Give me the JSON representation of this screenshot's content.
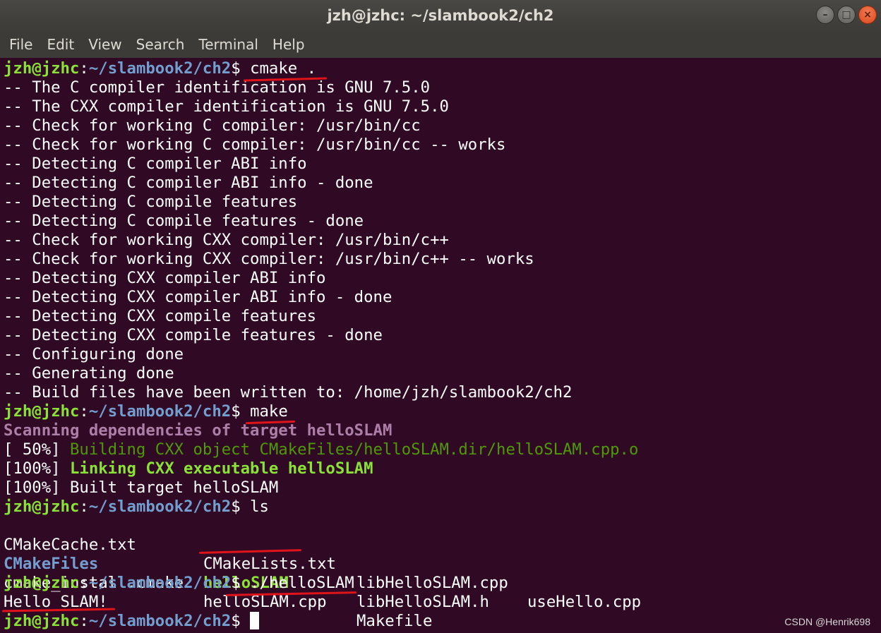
{
  "window": {
    "title": "jzh@jzhc: ~/slambook2/ch2",
    "buttons": {
      "minimize": "–",
      "maximize": "□",
      "close": "×"
    }
  },
  "menu": [
    "File",
    "Edit",
    "View",
    "Search",
    "Terminal",
    "Help"
  ],
  "prompt": {
    "user": "jzh@jzhc",
    "sep": ":",
    "path": "~/slambook2/ch2",
    "symbol": "$ "
  },
  "terminal": {
    "cmd1": "cmake .",
    "cmake_output": [
      "-- The C compiler identification is GNU 7.5.0",
      "-- The CXX compiler identification is GNU 7.5.0",
      "-- Check for working C compiler: /usr/bin/cc",
      "-- Check for working C compiler: /usr/bin/cc -- works",
      "-- Detecting C compiler ABI info",
      "-- Detecting C compiler ABI info - done",
      "-- Detecting C compile features",
      "-- Detecting C compile features - done",
      "-- Check for working CXX compiler: /usr/bin/c++",
      "-- Check for working CXX compiler: /usr/bin/c++ -- works",
      "-- Detecting CXX compiler ABI info",
      "-- Detecting CXX compiler ABI info - done",
      "-- Detecting CXX compile features",
      "-- Detecting CXX compile features - done",
      "-- Configuring done",
      "-- Generating done",
      "-- Build files have been written to: /home/jzh/slambook2/ch2"
    ],
    "cmd2": "make",
    "scan_line": "Scanning dependencies of target helloSLAM",
    "build_pct": "[ 50%] ",
    "build_msg": "Building CXX object CMakeFiles/helloSLAM.dir/helloSLAM.cpp.o",
    "link_pct": "[100%] ",
    "link_msg": "Linking CXX executable helloSLAM",
    "built_line": "[100%] Built target helloSLAM",
    "cmd3": "ls",
    "files": {
      "r1c1": "CMakeCache.txt",
      "r1c2": "CMakeLists.txt",
      "r1c3": "libHelloSLAM.cpp",
      "r1c4": "useHello.cpp",
      "r2c1": "CMakeFiles",
      "r2c2": "helloSLAM",
      "r2c3": "libHelloSLAM.h",
      "r3c1": "cmake_install.cmake",
      "r3c2": "helloSLAM.cpp",
      "r3c3": "Makefile"
    },
    "cmd4": "./helloSLAM",
    "program_output": "Hello SLAM!"
  },
  "watermark": "CSDN @Henrik698",
  "colors": {
    "background": "#300a24",
    "prompt_user": "#8ae234",
    "prompt_path": "#729fcf",
    "annotation": "#e0131b"
  }
}
